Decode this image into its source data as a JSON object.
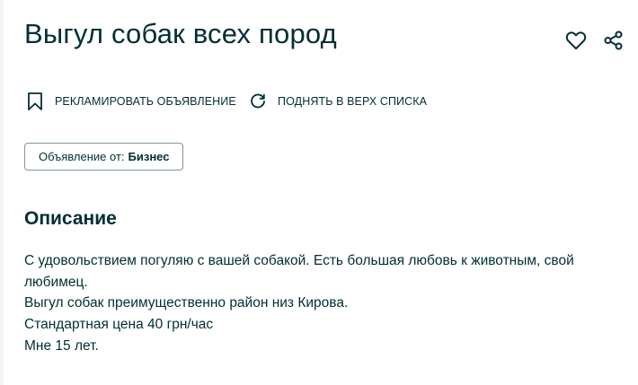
{
  "listing": {
    "title": "Выгул собак всех пород"
  },
  "actions": {
    "promote_label": "Рекламировать объявление",
    "lift_label": "Поднять в верх списка"
  },
  "seller": {
    "label": "Объявление от:",
    "value": "Бизнес"
  },
  "description": {
    "heading": "Описание",
    "lines": [
      "С удовольствием погуляю с вашей собакой. Есть большая любовь к животным, свой любимец.",
      "Выгул собак преимущественно район низ Кирова.",
      "Стандартная цена 40 грн/час",
      "Мне 15 лет."
    ]
  },
  "icons": {
    "favorite": "heart-icon",
    "share": "share-icon",
    "promote": "bookmark-icon",
    "lift": "refresh-icon"
  },
  "colors": {
    "text": "#002f34",
    "border": "#7f9799",
    "background": "#ffffff"
  }
}
